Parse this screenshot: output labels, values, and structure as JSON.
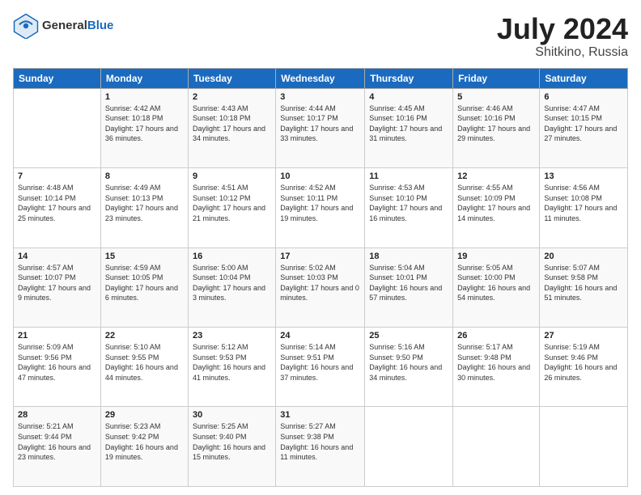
{
  "header": {
    "logo_general": "General",
    "logo_blue": "Blue",
    "title": "July 2024",
    "location": "Shitkino, Russia"
  },
  "days_of_week": [
    "Sunday",
    "Monday",
    "Tuesday",
    "Wednesday",
    "Thursday",
    "Friday",
    "Saturday"
  ],
  "weeks": [
    [
      {
        "day": "",
        "sunrise": "",
        "sunset": "",
        "daylight": ""
      },
      {
        "day": "1",
        "sunrise": "Sunrise: 4:42 AM",
        "sunset": "Sunset: 10:18 PM",
        "daylight": "Daylight: 17 hours and 36 minutes."
      },
      {
        "day": "2",
        "sunrise": "Sunrise: 4:43 AM",
        "sunset": "Sunset: 10:18 PM",
        "daylight": "Daylight: 17 hours and 34 minutes."
      },
      {
        "day": "3",
        "sunrise": "Sunrise: 4:44 AM",
        "sunset": "Sunset: 10:17 PM",
        "daylight": "Daylight: 17 hours and 33 minutes."
      },
      {
        "day": "4",
        "sunrise": "Sunrise: 4:45 AM",
        "sunset": "Sunset: 10:16 PM",
        "daylight": "Daylight: 17 hours and 31 minutes."
      },
      {
        "day": "5",
        "sunrise": "Sunrise: 4:46 AM",
        "sunset": "Sunset: 10:16 PM",
        "daylight": "Daylight: 17 hours and 29 minutes."
      },
      {
        "day": "6",
        "sunrise": "Sunrise: 4:47 AM",
        "sunset": "Sunset: 10:15 PM",
        "daylight": "Daylight: 17 hours and 27 minutes."
      }
    ],
    [
      {
        "day": "7",
        "sunrise": "Sunrise: 4:48 AM",
        "sunset": "Sunset: 10:14 PM",
        "daylight": "Daylight: 17 hours and 25 minutes."
      },
      {
        "day": "8",
        "sunrise": "Sunrise: 4:49 AM",
        "sunset": "Sunset: 10:13 PM",
        "daylight": "Daylight: 17 hours and 23 minutes."
      },
      {
        "day": "9",
        "sunrise": "Sunrise: 4:51 AM",
        "sunset": "Sunset: 10:12 PM",
        "daylight": "Daylight: 17 hours and 21 minutes."
      },
      {
        "day": "10",
        "sunrise": "Sunrise: 4:52 AM",
        "sunset": "Sunset: 10:11 PM",
        "daylight": "Daylight: 17 hours and 19 minutes."
      },
      {
        "day": "11",
        "sunrise": "Sunrise: 4:53 AM",
        "sunset": "Sunset: 10:10 PM",
        "daylight": "Daylight: 17 hours and 16 minutes."
      },
      {
        "day": "12",
        "sunrise": "Sunrise: 4:55 AM",
        "sunset": "Sunset: 10:09 PM",
        "daylight": "Daylight: 17 hours and 14 minutes."
      },
      {
        "day": "13",
        "sunrise": "Sunrise: 4:56 AM",
        "sunset": "Sunset: 10:08 PM",
        "daylight": "Daylight: 17 hours and 11 minutes."
      }
    ],
    [
      {
        "day": "14",
        "sunrise": "Sunrise: 4:57 AM",
        "sunset": "Sunset: 10:07 PM",
        "daylight": "Daylight: 17 hours and 9 minutes."
      },
      {
        "day": "15",
        "sunrise": "Sunrise: 4:59 AM",
        "sunset": "Sunset: 10:05 PM",
        "daylight": "Daylight: 17 hours and 6 minutes."
      },
      {
        "day": "16",
        "sunrise": "Sunrise: 5:00 AM",
        "sunset": "Sunset: 10:04 PM",
        "daylight": "Daylight: 17 hours and 3 minutes."
      },
      {
        "day": "17",
        "sunrise": "Sunrise: 5:02 AM",
        "sunset": "Sunset: 10:03 PM",
        "daylight": "Daylight: 17 hours and 0 minutes."
      },
      {
        "day": "18",
        "sunrise": "Sunrise: 5:04 AM",
        "sunset": "Sunset: 10:01 PM",
        "daylight": "Daylight: 16 hours and 57 minutes."
      },
      {
        "day": "19",
        "sunrise": "Sunrise: 5:05 AM",
        "sunset": "Sunset: 10:00 PM",
        "daylight": "Daylight: 16 hours and 54 minutes."
      },
      {
        "day": "20",
        "sunrise": "Sunrise: 5:07 AM",
        "sunset": "Sunset: 9:58 PM",
        "daylight": "Daylight: 16 hours and 51 minutes."
      }
    ],
    [
      {
        "day": "21",
        "sunrise": "Sunrise: 5:09 AM",
        "sunset": "Sunset: 9:56 PM",
        "daylight": "Daylight: 16 hours and 47 minutes."
      },
      {
        "day": "22",
        "sunrise": "Sunrise: 5:10 AM",
        "sunset": "Sunset: 9:55 PM",
        "daylight": "Daylight: 16 hours and 44 minutes."
      },
      {
        "day": "23",
        "sunrise": "Sunrise: 5:12 AM",
        "sunset": "Sunset: 9:53 PM",
        "daylight": "Daylight: 16 hours and 41 minutes."
      },
      {
        "day": "24",
        "sunrise": "Sunrise: 5:14 AM",
        "sunset": "Sunset: 9:51 PM",
        "daylight": "Daylight: 16 hours and 37 minutes."
      },
      {
        "day": "25",
        "sunrise": "Sunrise: 5:16 AM",
        "sunset": "Sunset: 9:50 PM",
        "daylight": "Daylight: 16 hours and 34 minutes."
      },
      {
        "day": "26",
        "sunrise": "Sunrise: 5:17 AM",
        "sunset": "Sunset: 9:48 PM",
        "daylight": "Daylight: 16 hours and 30 minutes."
      },
      {
        "day": "27",
        "sunrise": "Sunrise: 5:19 AM",
        "sunset": "Sunset: 9:46 PM",
        "daylight": "Daylight: 16 hours and 26 minutes."
      }
    ],
    [
      {
        "day": "28",
        "sunrise": "Sunrise: 5:21 AM",
        "sunset": "Sunset: 9:44 PM",
        "daylight": "Daylight: 16 hours and 23 minutes."
      },
      {
        "day": "29",
        "sunrise": "Sunrise: 5:23 AM",
        "sunset": "Sunset: 9:42 PM",
        "daylight": "Daylight: 16 hours and 19 minutes."
      },
      {
        "day": "30",
        "sunrise": "Sunrise: 5:25 AM",
        "sunset": "Sunset: 9:40 PM",
        "daylight": "Daylight: 16 hours and 15 minutes."
      },
      {
        "day": "31",
        "sunrise": "Sunrise: 5:27 AM",
        "sunset": "Sunset: 9:38 PM",
        "daylight": "Daylight: 16 hours and 11 minutes."
      },
      {
        "day": "",
        "sunrise": "",
        "sunset": "",
        "daylight": ""
      },
      {
        "day": "",
        "sunrise": "",
        "sunset": "",
        "daylight": ""
      },
      {
        "day": "",
        "sunrise": "",
        "sunset": "",
        "daylight": ""
      }
    ]
  ]
}
